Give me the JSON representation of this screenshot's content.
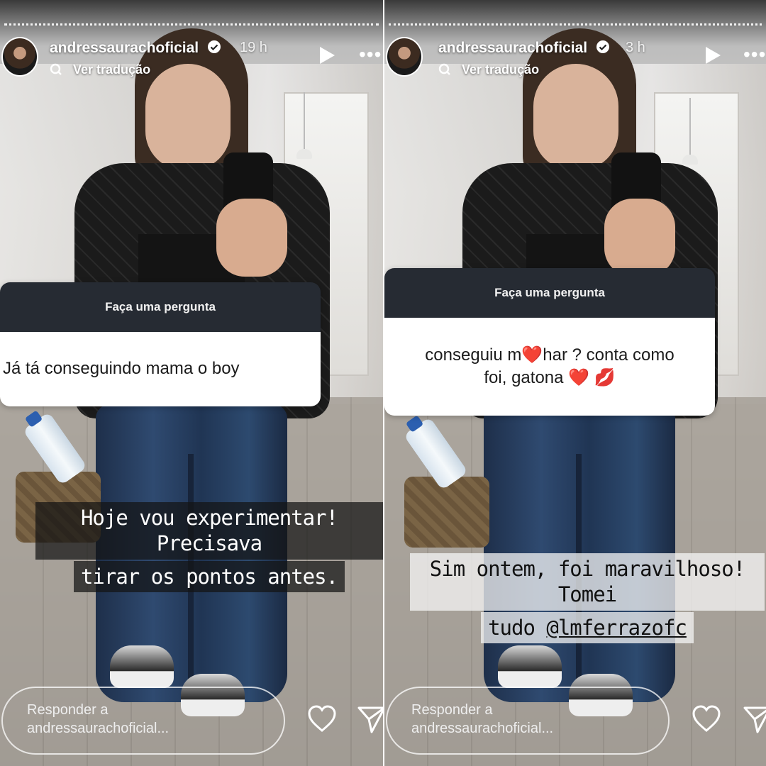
{
  "stories": [
    {
      "username": "andressaurachoficial",
      "time": "19 h",
      "translate_label": "Ver tradução",
      "question": {
        "header": "Faça uma pergunta",
        "text": "Já tá conseguindo mama o boy"
      },
      "caption": {
        "line1": "Hoje vou experimentar! Precisava",
        "line2": "tirar os pontos antes.",
        "mention": ""
      },
      "reply_placeholder_line1": "Responder a",
      "reply_placeholder_line2": "andressaurachoficial..."
    },
    {
      "username": "andressaurachoficial",
      "time": "3 h",
      "translate_label": "Ver tradução",
      "question": {
        "header": "Faça uma pergunta",
        "text_line1": "conseguiu m❤️har ? conta como",
        "text_line2": "foi, gatona ❤️ 💋"
      },
      "caption": {
        "line1": "Sim ontem, foi maravilhoso! Tomei",
        "line2": "tudo ",
        "mention": "@lmferrazofc"
      },
      "reply_placeholder_line1": "Responder a",
      "reply_placeholder_line2": "andressaurachoficial..."
    }
  ],
  "icons": {
    "verified": "verified-badge-icon",
    "translate": "translate-icon",
    "play": "play-icon",
    "more": "more-options-icon",
    "heart": "heart-icon",
    "send": "send-icon"
  },
  "colors": {
    "question_header_bg": "#262b33",
    "question_body_bg": "#ffffff",
    "text_white": "#ffffff"
  }
}
